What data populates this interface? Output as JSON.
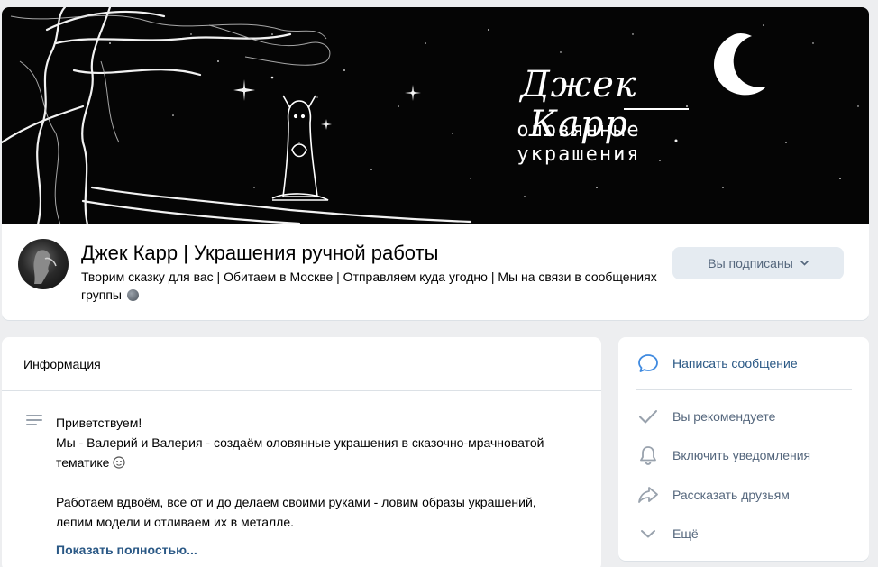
{
  "cover": {
    "title_script": "Джек Карр",
    "subtitle_line1": "оловянные",
    "subtitle_line2": "украшения"
  },
  "group": {
    "name": "Джек Карр | Украшения ручной работы",
    "status": "Творим сказку для вас | Обитаем в Москве | Отправляем куда угодно | Мы на связи в сообщениях группы",
    "subscribe_button": "Вы подписаны",
    "subscribe_icon": "chevron-down-icon"
  },
  "info": {
    "title": "Информация",
    "icon": "text-lines-icon",
    "lines": [
      "Приветствуем!",
      "Мы - Валерий и Валерия - создаём оловянные украшения в сказочно-мрачноватой тематике"
    ],
    "paragraph2": "Работаем вдвоём, все от и до делаем своими руками - ловим образы украшений, лепим модели и отливаем их в металле.",
    "show_more": "Показать полностью..."
  },
  "actions": {
    "items": [
      {
        "label": "Написать сообщение",
        "icon": "message-bubble-icon"
      },
      {
        "label": "Вы рекомендуете",
        "icon": "checkmark-icon"
      },
      {
        "label": "Включить уведомления",
        "icon": "bell-icon"
      },
      {
        "label": "Рассказать друзьям",
        "icon": "share-arrow-icon"
      },
      {
        "label": "Ещё",
        "icon": "chevron-down-icon"
      }
    ]
  },
  "colors": {
    "link": "#2a5885",
    "muted": "#55677d",
    "button_bg": "#e5ebf1",
    "page_bg": "#edeef0",
    "accent_icon": "#3f8ae0"
  }
}
